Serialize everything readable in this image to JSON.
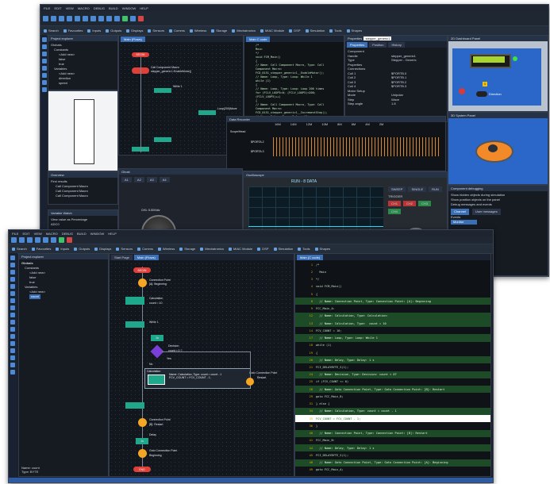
{
  "back_window": {
    "menu": [
      "FILE",
      "EDIT",
      "VIEW",
      "MACRO",
      "DEBUG",
      "BUILD",
      "WINDOW",
      "HELP"
    ],
    "ribbon": [
      "Search",
      "Favourites",
      "Inputs",
      "Outputs",
      "Displays",
      "Sensors",
      "Comms",
      "Wireless",
      "Storage",
      "Mechatronics",
      "MIAC Module",
      "DSP",
      "Simulation",
      "Tools",
      "Shapes"
    ],
    "project_explorer": {
      "title": "Project explorer",
      "items": [
        "Globals",
        "Constants",
        "<Add new>",
        "false",
        "true",
        "Variables",
        "<Add new>",
        "direction",
        "speed"
      ]
    },
    "tabs": [
      "Main (Flows)",
      "Main C code"
    ],
    "flow": {
      "begin": "BEGIN",
      "call": "Call Component Macro",
      "call_sub": "stepper_generic1::EnableMotor()",
      "loop": "While 1",
      "loop_cond": "Loop(200)Move",
      "delay": "Delay",
      "decision_label": "Direct"
    },
    "code_lines": [
      "/*",
      "Main",
      "*/",
      "void FCM_Main()",
      "{",
      "// Name: Call Component Macro, Type: Call Component Macro:",
      "FCD_0151_stepper_generic1__EnableMotor();",
      "// Name: Loop, Type: Loop: While 1",
      "while (1)",
      "{",
      "// Name: Loop, Type: Loop: Loop 200 times",
      "for (FCLV_LOOP5=0; (FCLV_LOOP5)<200; (FCLV_LOOP5)++)",
      "{",
      "// Name: Call Component Macro, Type: Call Component Macro:",
      "FCD_0151_stepper_generic1__IncrementStep();",
      "// Name: Delay, Type: Delay: 10 ms"
    ],
    "properties": {
      "title": "Properties",
      "component": "stepper_generic1",
      "tabs": [
        "Properties",
        "Position",
        "History"
      ],
      "rows": [
        [
          "Component",
          ""
        ],
        [
          "Handle",
          "stepper_generic1"
        ],
        [
          "Type",
          "Stepper - Generic"
        ],
        [
          "Properties",
          ""
        ],
        [
          "Connections",
          ""
        ],
        [
          "Coil 1",
          "$PORTB.0"
        ],
        [
          "Coil 2",
          "$PORTB.1"
        ],
        [
          "Coil 3",
          "$PORTB.2"
        ],
        [
          "Coil 4",
          "$PORTB.3"
        ],
        [
          "Motor Setup",
          ""
        ],
        [
          "Mode",
          "Unipolar"
        ],
        [
          "Step",
          "Wave"
        ],
        [
          "Step angle",
          "1.8"
        ]
      ]
    },
    "dashboard_panel": {
      "title": "2D Dashboard Panel",
      "direction": "Direction",
      "badge": "1"
    },
    "system_panel": {
      "title": "3D System Panel"
    },
    "data_recorder": {
      "title": "Data Recorder",
      "header_label": "Scope/Head",
      "times": [
        "16M",
        "14M",
        "12M",
        "10M",
        "8M",
        "6M",
        "4M",
        "2M"
      ],
      "channels": [
        "$PORTA.2",
        "$PORTA.3"
      ]
    },
    "oscilloscope": {
      "title": "Oscilloscope",
      "run_label": "RUN - 8 DATA",
      "buttons": [
        "SWEEP",
        "SINGLE",
        "RUN"
      ],
      "trigger": "TRIGGER",
      "channels": [
        "CH1",
        "CH2",
        "CH3",
        "CH4"
      ]
    },
    "ghost_panel": {
      "title": "Ghost",
      "knob_label": "CH1: 5.00V/div",
      "channel_tabs": [
        "A1",
        "A2",
        "A3",
        "A4"
      ]
    },
    "overview": {
      "title": "Overview",
      "results_label": "Find results",
      "results": [
        "Call Component Macro",
        "Call Component Macro",
        "Call Component Macro"
      ]
    },
    "variable_watch": {
      "title": "Variable Watch",
      "header": "View value as",
      "value": "Percentage",
      "row": "ADC0"
    },
    "debug_settings": {
      "title": "Component debugging",
      "options": [
        "Show hidden objects during simulation",
        "Show position objects on the panel",
        "Debug messages and events"
      ],
      "tabs": [
        "Channel",
        "User messages"
      ],
      "list_header": "Events",
      "list_item": "Monitor"
    }
  },
  "front_window": {
    "menu": [
      "FILE",
      "EDIT",
      "VIEW",
      "MACRO",
      "DEBUG",
      "BUILD",
      "WINDOW",
      "HELP"
    ],
    "ribbon": [
      "Search",
      "Favourites",
      "Inputs",
      "Outputs",
      "Displays",
      "Sensors",
      "Comms",
      "Wireless",
      "Storage",
      "Mechatronics",
      "MIAC Module",
      "DSP",
      "Simulation",
      "Tools",
      "Shapes"
    ],
    "project_explorer": {
      "title": "Project explorer",
      "items": [
        "Globals",
        "Constants",
        "<Add new>",
        "false",
        "true",
        "Variables",
        "<Add new>",
        "count"
      ]
    },
    "tabs": [
      "Start Page",
      "Main (Flows)"
    ],
    "code_tab": "Main (C code)",
    "flow": {
      "begin": "BEGIN",
      "conn_a": "Connection Point",
      "conn_a_sub": "[A]: Beginning",
      "calc": "Calculation",
      "calc_sub": "count = 10",
      "loop": "While 1",
      "delay": "1s",
      "decision": "Decision",
      "decision_sub": "count < 0 ?",
      "yes": "Yes",
      "no": "No",
      "calc2_title": "Calculation",
      "calc2_l1": "Name: Calculation, Type: count = count - 1",
      "calc2_l2": "FCV_COUNT = FCV_COUNT - 1;",
      "goto": "Goto Connection Point",
      "goto_sub": "Restart",
      "conn_b": "Connection Point",
      "conn_b_sub": "[B]: Restart",
      "delay2": "1s",
      "delay2_label": "Delay",
      "goto2": "Goto Connection Point",
      "goto2_sub": "Beginning",
      "end": "END"
    },
    "code": [
      {
        "ln": "1",
        "t": "/*"
      },
      {
        "ln": "2",
        "t": "  Main"
      },
      {
        "ln": "3",
        "t": "*/"
      },
      {
        "ln": "4",
        "t": "void FCM_Main()"
      },
      {
        "ln": "5",
        "t": "{"
      },
      {
        "ln": "8",
        "t": "  // Name: Connection Point, Type: Connection Point: [A]: Beginning"
      },
      {
        "ln": "9",
        "t": "FCC_Main_A:"
      },
      {
        "ln": "12",
        "t": "  // Name: Calculation, Type: Calculation:"
      },
      {
        "ln": "13",
        "t": "  // Name: Calculation, Type:  count = 10"
      },
      {
        "ln": "14",
        "t": "FCV_COUNT = 10;"
      },
      {
        "ln": "17",
        "t": "  // Name: Loop, Type: Loop: While 1"
      },
      {
        "ln": "18",
        "t": "while (1)"
      },
      {
        "ln": "19",
        "t": "{"
      },
      {
        "ln": "20",
        "t": "  // Name: Delay, Type: Delay: 1 s"
      },
      {
        "ln": "21",
        "t": "FCI_DELAYBYTE_S(1);"
      },
      {
        "ln": "24",
        "t": "  // Name: Decision, Type: Decision: count < 0?"
      },
      {
        "ln": "25",
        "t": "if (FCV_COUNT <= 0)"
      },
      {
        "ln": "28",
        "t": "  // Name: Goto Connection Point, Type: Goto Connection Point: [B]: Restart"
      },
      {
        "ln": "29",
        "t": "goto FCC_Main_B;"
      },
      {
        "ln": "31",
        "t": "} else {"
      },
      {
        "ln": "34",
        "t": "  // Name: Calculation, Type: count = count - 1"
      },
      {
        "ln": "35",
        "t": "FCV_COUNT = FCV_COUNT - 1;"
      },
      {
        "ln": "36",
        "t": "}"
      },
      {
        "ln": "40",
        "t": "  // Name: Connection Point, Type: Connection Point: [B]: Restart"
      },
      {
        "ln": "41",
        "t": "FCC_Main_B:"
      },
      {
        "ln": "44",
        "t": "  // Name: Delay, Type: Delay: 1 s"
      },
      {
        "ln": "45",
        "t": "FCI_DELAYBYTE_S(1);"
      },
      {
        "ln": "48",
        "t": "  // Name: Goto Connection Point, Type: Goto Connection Point: [A]: Beginning"
      },
      {
        "ln": "49",
        "t": "goto FCC_Main_A;"
      }
    ],
    "status": {
      "name_label": "Name:",
      "name_value": "count",
      "type_label": "Type:",
      "type_value": "BYTE"
    }
  },
  "colors": {
    "accent": "#3b6fb5",
    "terminator": "#e0403a",
    "block": "#1fa88b",
    "connector": "#f5a623",
    "decision": "#7a3fd6",
    "highlight": "#ffffff"
  }
}
